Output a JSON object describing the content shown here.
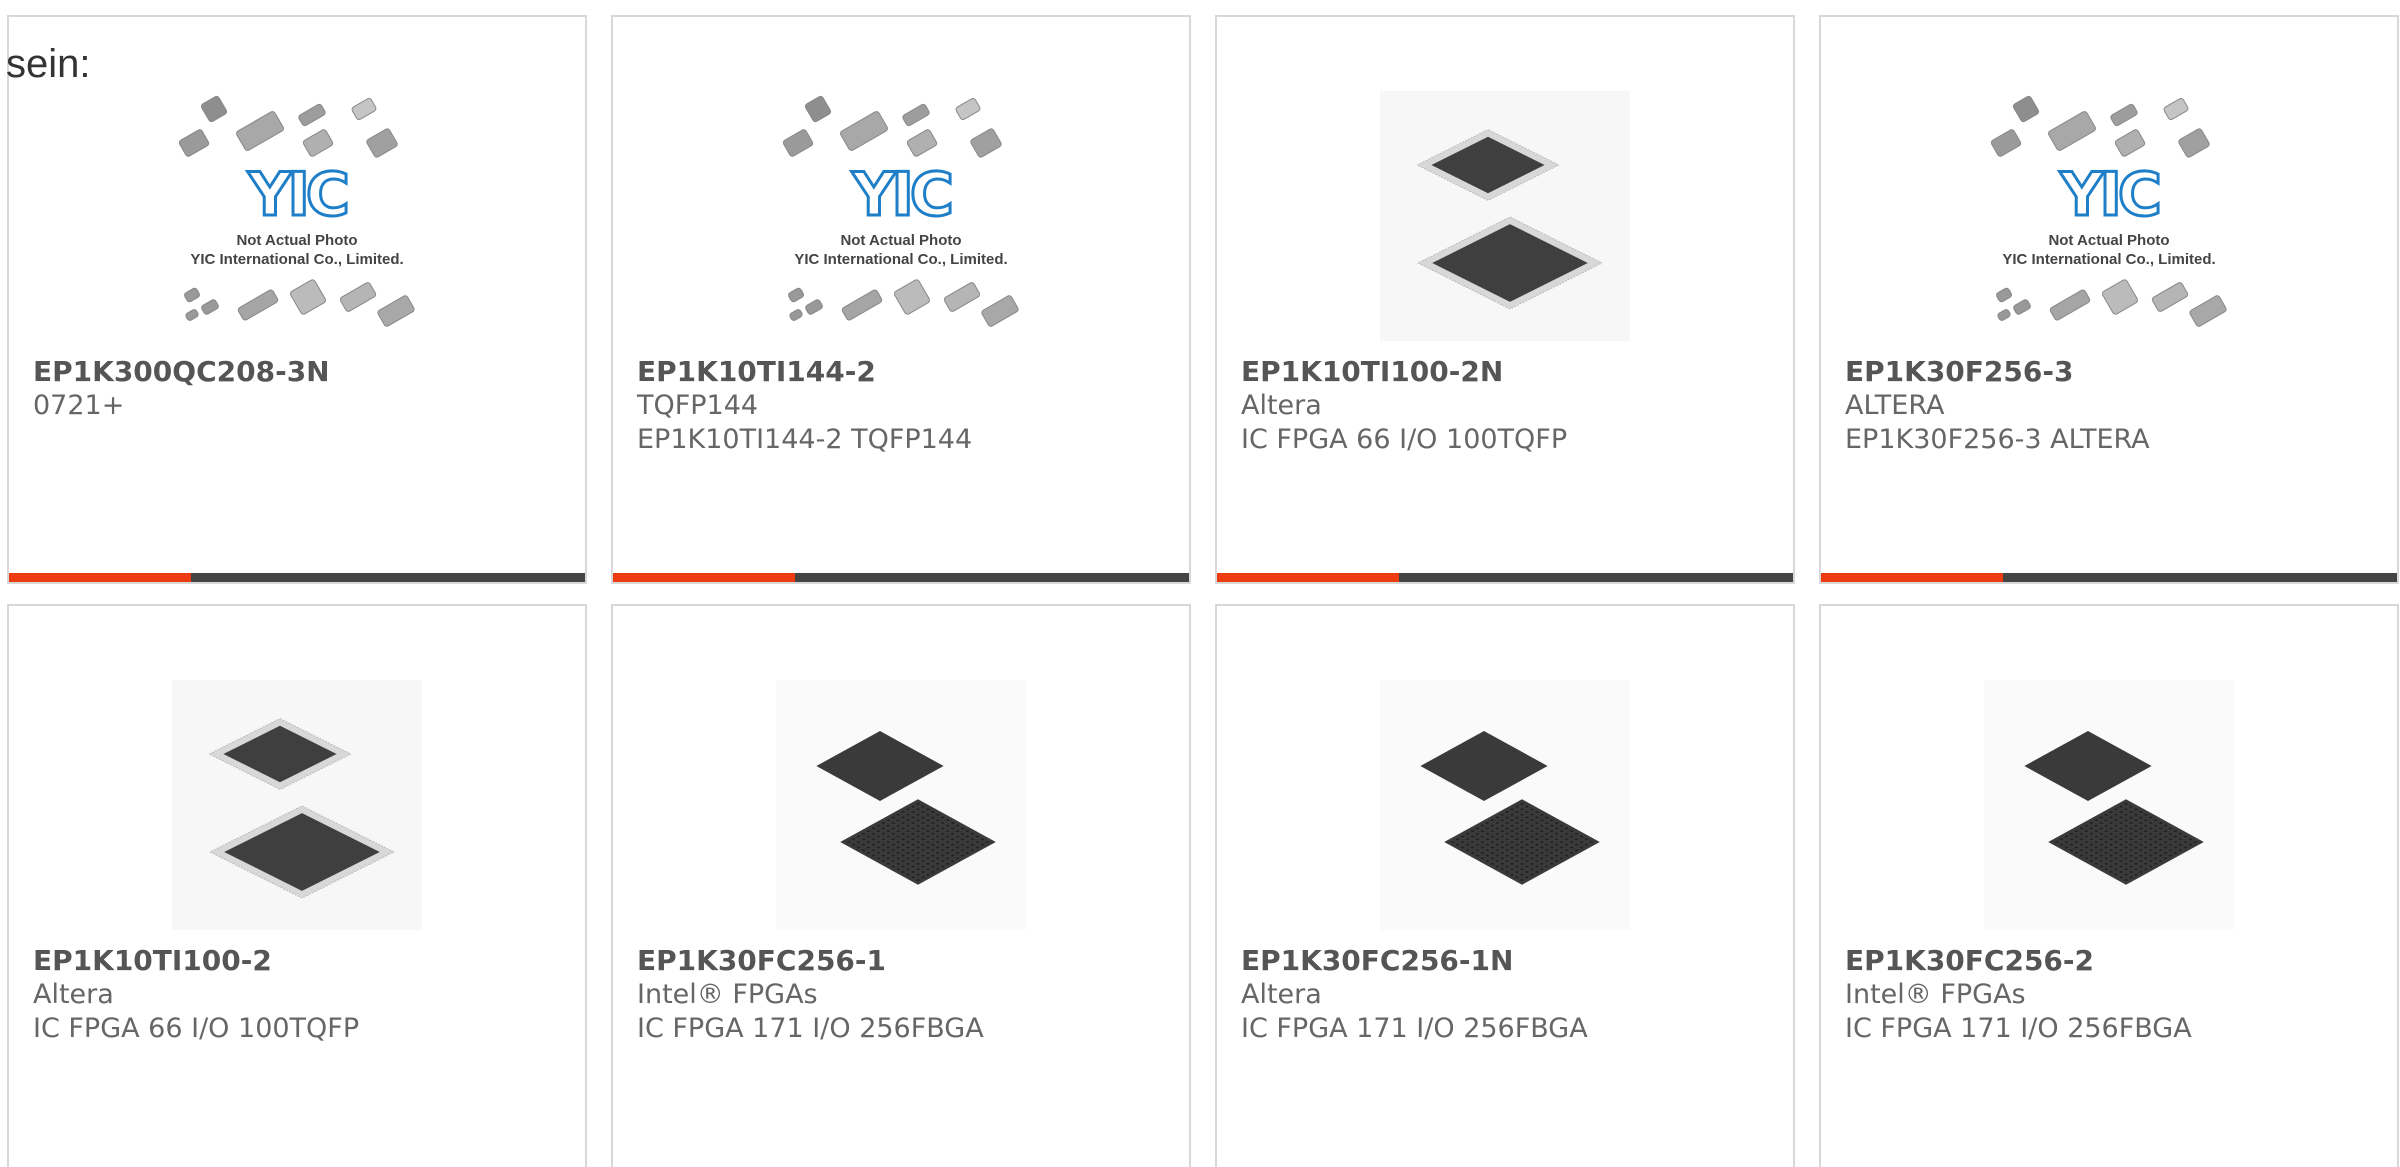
{
  "page": {
    "intro_text": "sein:"
  },
  "colors": {
    "card_border": "#d8d8d8",
    "bar_dark": "#444444",
    "bar_accent": "#ee3c12",
    "title_text": "#555555",
    "body_text": "#666666",
    "logo_blue": "#1e7fc8"
  },
  "placeholder_image": {
    "line1": "Not Actual Photo",
    "line2": "YIC International Co., Limited."
  },
  "products": [
    {
      "part_number": "EP1K300QC208-3N",
      "line1": "0721+",
      "line2": "",
      "image": "placeholder-logo"
    },
    {
      "part_number": "EP1K10TI144-2",
      "line1": "TQFP144",
      "line2": "EP1K10TI144-2 TQFP144",
      "image": "placeholder-logo"
    },
    {
      "part_number": "EP1K10TI100-2N",
      "line1": "Altera",
      "line2": "IC FPGA 66 I/O 100TQFP",
      "image": "tqfp-chip"
    },
    {
      "part_number": "EP1K30F256-3",
      "line1": "ALTERA",
      "line2": "EP1K30F256-3 ALTERA",
      "image": "placeholder-logo"
    },
    {
      "part_number": "EP1K10TI100-2",
      "line1": "Altera",
      "line2": "IC FPGA 66 I/O 100TQFP",
      "image": "tqfp-chip"
    },
    {
      "part_number": "EP1K30FC256-1",
      "line1": "Intel® FPGAs",
      "line2": "IC FPGA 171 I/O 256FBGA",
      "image": "bga-chip"
    },
    {
      "part_number": "EP1K30FC256-1N",
      "line1": "Altera",
      "line2": "IC FPGA 171 I/O 256FBGA",
      "image": "bga-chip"
    },
    {
      "part_number": "EP1K30FC256-2",
      "line1": "Intel® FPGAs",
      "line2": "IC FPGA 171 I/O 256FBGA",
      "image": "bga-chip"
    }
  ]
}
